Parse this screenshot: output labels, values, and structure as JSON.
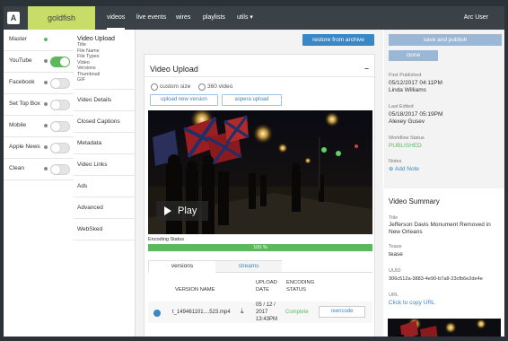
{
  "topbar": {
    "logo": "A",
    "brand": "goldfish",
    "nav": [
      "videos",
      "live events",
      "wires",
      "playlists",
      "utils ▾"
    ],
    "user": "Arc User"
  },
  "distribution": [
    {
      "label": "Master",
      "state": "dot-green"
    },
    {
      "label": "YouTube",
      "state": "on"
    },
    {
      "label": "Facebook",
      "state": "off"
    },
    {
      "label": "Set Top Box",
      "state": "off"
    },
    {
      "label": "Mobile",
      "state": "off"
    },
    {
      "label": "Apple News",
      "state": "off"
    },
    {
      "label": "Clean",
      "state": "off"
    }
  ],
  "sections": {
    "first": {
      "title": "Video Upload",
      "subs": [
        "Title",
        "File Name",
        "File Types",
        "Video",
        "Versions",
        "Thumbnail",
        "GIF"
      ]
    },
    "items": [
      "Video Details",
      "Closed Captions",
      "Metadata",
      "Video Links",
      "Ads",
      "Advanced",
      "WebSked"
    ]
  },
  "main": {
    "restore": "restore from archive",
    "card_title": "Video Upload",
    "collapse": "–",
    "options": [
      "custom size",
      "360 video"
    ],
    "upload_new": "upload new version",
    "aspera": "aspera upload",
    "play": "Play",
    "encoding_label": "Encoding Status",
    "progress_value": 100,
    "progress_text": "100 %",
    "tabs": [
      "versions",
      "streams"
    ],
    "table": {
      "headers": [
        "VERSION NAME",
        "UPLOAD DATE",
        "ENCODING STATUS"
      ],
      "row": {
        "filename": "t_149461101....523.mp4",
        "download_icon": "download-icon",
        "date": [
          "05 / 12 /",
          "2017",
          "13:43PM"
        ],
        "status": "Complete",
        "action": "reencode"
      }
    }
  },
  "right": {
    "save": "save and publish",
    "clone": "clone",
    "first_published_label": "First Published",
    "first_published": "05/12/2017 04:11PM",
    "first_published_by": "Linda Williams",
    "last_edited_label": "Last Edited",
    "last_edited": "05/18/2017 05:19PM",
    "last_edited_by": "Alexey Gusev",
    "workflow_label": "Workflow Status",
    "workflow": "PUBLISHED",
    "notes_label": "Notes",
    "add_note": "Add Note",
    "summary_title": "Video Summary",
    "title_label": "Title",
    "title": "Jefferson Davis Monument Removed in New Orleans",
    "tease_label": "Tease",
    "tease": "tease",
    "uuid_label": "UUID",
    "uuid": "306c512a-3883-4e90-b7a8-23cfb6e2de4e",
    "url_label": "URL",
    "url": "Click to copy URL"
  },
  "colors": {
    "accent": "#3a87c8",
    "brand": "#c8dc68",
    "success": "#5cb85c",
    "topbar": "#3b4247"
  }
}
